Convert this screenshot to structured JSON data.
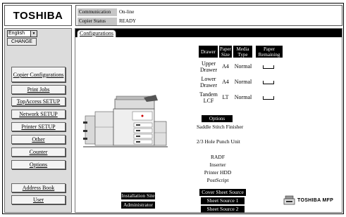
{
  "header": {
    "logo": "TOSHIBA",
    "communication_label": "Communication",
    "communication_value": "On-line",
    "copier_status_label": "Copier Status",
    "copier_status_value": "READY"
  },
  "sidebar": {
    "language": "English",
    "change_label": "CHANGE",
    "items": [
      {
        "label": "Copier Configurations"
      },
      {
        "label": "Print Jobs"
      },
      {
        "label": "TopAccess SETUP"
      },
      {
        "label": "Network SETUP"
      },
      {
        "label": "Printer SETUP"
      },
      {
        "label": "Other"
      },
      {
        "label": "Counter"
      },
      {
        "label": "Options"
      },
      {
        "label": "Address Book"
      },
      {
        "label": "User"
      }
    ]
  },
  "main": {
    "tab_label": "Configurations",
    "drawer_table": {
      "headers": [
        "Drawer",
        "Paper Size",
        "Media Type",
        "Paper Remaining"
      ],
      "rows": [
        {
          "drawer": "Upper Drawer",
          "size": "A4",
          "media": "Normal"
        },
        {
          "drawer": "Lower Drawer",
          "size": "A4",
          "media": "Normal"
        },
        {
          "drawer": "Tandem LCF",
          "size": "LT",
          "media": "Normal"
        }
      ]
    },
    "options_header": "Options",
    "options": [
      "Saddle Stitch Finisher",
      "2/3 Hole Punch Unit",
      "RADF",
      "Inserter",
      "Printer HDD",
      "PostScript"
    ],
    "buttons": {
      "installation_site": "Installation Site",
      "administrator": "Administrator",
      "cover_sheet_source": "Cover Sheet Source",
      "sheet_source_1": "Sheet Source 1",
      "sheet_source_2": "Sheet Source 2"
    },
    "brand": "TOSHIBA MFP"
  }
}
